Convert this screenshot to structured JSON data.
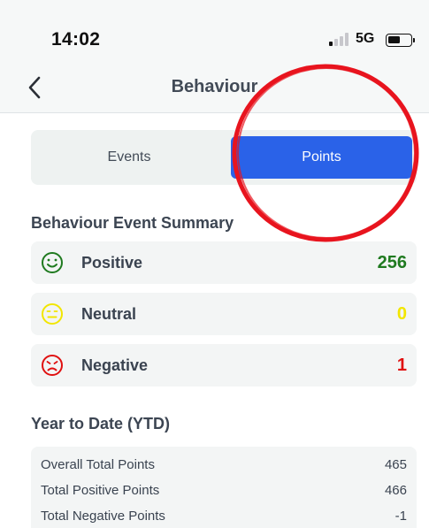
{
  "status_bar": {
    "time": "14:02",
    "network": "5G"
  },
  "nav": {
    "title": "Behaviour",
    "back_icon": "chevron-left-icon"
  },
  "tabs": [
    {
      "label": "Events",
      "selected": false
    },
    {
      "label": "Points",
      "selected": true
    }
  ],
  "summary": {
    "title": "Behaviour Event Summary",
    "items": [
      {
        "label": "Positive",
        "count": "256",
        "icon": "smile-icon",
        "color": "#1f7a1f"
      },
      {
        "label": "Neutral",
        "count": "0",
        "icon": "neutral-face-icon",
        "color": "#f2e600"
      },
      {
        "label": "Negative",
        "count": "1",
        "icon": "sad-face-icon",
        "color": "#e01010"
      }
    ]
  },
  "ytd": {
    "title": "Year to Date (YTD)",
    "rows": [
      {
        "label": "Overall Total Points",
        "value": "465"
      },
      {
        "label": "Total Positive Points",
        "value": "466"
      },
      {
        "label": "Total Negative Points",
        "value": "-1"
      }
    ]
  },
  "colors": {
    "accent": "#2a62e8",
    "annotation_circle": "#e8141e",
    "header_bg": "#f6f8f8",
    "card_bg": "#f3f5f5"
  }
}
